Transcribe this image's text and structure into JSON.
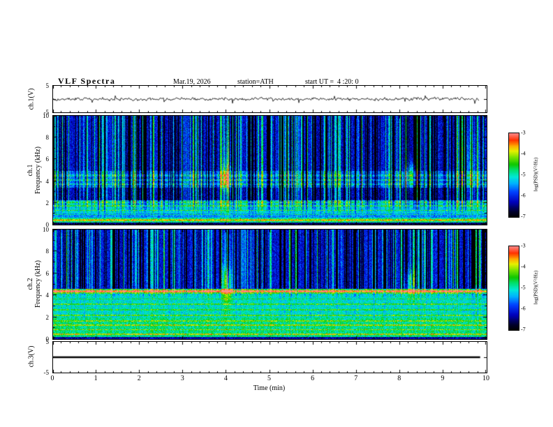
{
  "header": {
    "title": "VLF Spectra",
    "date": "Mar.19, 2026",
    "station": "station=ATH",
    "start_ut": "start UT =  4 :20: 0"
  },
  "panels": {
    "wave1": {
      "rot_label": "ch.1(V)"
    },
    "spec1": {
      "channel": "ch.1",
      "axis": "Frequency (kHz)"
    },
    "spec2": {
      "channel": "ch.2",
      "axis": "Frequency (kHz)"
    },
    "wave3": {
      "rot_label": "ch.3(V)"
    }
  },
  "axes": {
    "x": {
      "label": "Time (min)",
      "ticks": [
        0,
        1,
        2,
        3,
        4,
        5,
        6,
        7,
        8,
        9,
        10
      ]
    },
    "spec_y": {
      "ticks": [
        0,
        2,
        4,
        6,
        8,
        10
      ]
    },
    "wave_y": {
      "ticks": [
        5,
        -5
      ]
    },
    "colorbar": {
      "label": "log(PSD)(V²/Hz)",
      "ticks": [
        -3,
        -4,
        -5,
        -6,
        -7
      ]
    }
  },
  "colormap": [
    {
      "t": 0.0,
      "c": "#000000"
    },
    {
      "t": 0.07,
      "c": "#000030"
    },
    {
      "t": 0.18,
      "c": "#0000bb"
    },
    {
      "t": 0.3,
      "c": "#0040ff"
    },
    {
      "t": 0.4,
      "c": "#00b0ff"
    },
    {
      "t": 0.48,
      "c": "#00e8d8"
    },
    {
      "t": 0.56,
      "c": "#00e070"
    },
    {
      "t": 0.63,
      "c": "#10c800"
    },
    {
      "t": 0.72,
      "c": "#80e400"
    },
    {
      "t": 0.79,
      "c": "#e8f000"
    },
    {
      "t": 0.85,
      "c": "#ffa800"
    },
    {
      "t": 0.92,
      "c": "#ff3000"
    },
    {
      "t": 1.0,
      "c": "#ff8888"
    }
  ],
  "chart_data": [
    {
      "type": "line",
      "name": "ch.1 waveform",
      "ylabel": "ch.1(V)",
      "ylim": [
        -5,
        5
      ],
      "xlim": [
        0,
        10
      ],
      "description": "broadband noise around 0 V, about ±1 V, with intermittent impulsive spikes up to about ±3 V",
      "render": {
        "seed": 101,
        "noise_amp": 0.85,
        "spike_prob": 0.02,
        "spike_amp": 2.2,
        "end_frac": 0.985
      }
    },
    {
      "type": "heatmap",
      "name": "ch.1 spectrogram",
      "ylabel": "Frequency (kHz)",
      "ylim": [
        0,
        10
      ],
      "xlim": [
        0,
        10
      ],
      "value_label": "log(PSD)(V²/Hz)",
      "value_range": [
        -7,
        -3
      ],
      "features": [
        "dense vertical sferic streaks spanning 2-10 kHz",
        "banded emissions below 2.3 kHz (green with red speckle lines)",
        "hiss band near 3.4-5 kHz",
        "bright emission burst at 4.0 min, 3-6 kHz",
        "weaker burst at 8.25 min, 3.5-5.5 kHz",
        "diffuse enhancement near 9.6 min above 3 kHz"
      ],
      "render": {
        "seed": 202,
        "noise": 0.75,
        "dark_streak_prob": 0.3,
        "bright_streak_prob": 0.22,
        "streak_min_f": 1.0,
        "streak_full_f": 2.6,
        "bands": [
          {
            "f0": 0,
            "f1": 0.25,
            "v": -6.6
          },
          {
            "f0": 0.25,
            "f1": 0.7,
            "v": -4.9
          },
          {
            "f0": 0.7,
            "f1": 1.05,
            "v": -5.5
          },
          {
            "f0": 1.05,
            "f1": 2.3,
            "v": -5.15
          },
          {
            "f0": 2.3,
            "f1": 3.4,
            "v": -6.25
          },
          {
            "f0": 3.4,
            "f1": 5.0,
            "v": -5.65
          },
          {
            "f0": 5.0,
            "f1": 10.01,
            "v": -6.15
          }
        ],
        "lines": [
          {
            "f": 0.45,
            "w": 0.07,
            "amp": 1.25
          },
          {
            "f": 0.95,
            "w": 0.05,
            "amp": 0.85
          },
          {
            "f": 1.35,
            "w": 0.06,
            "amp": 0.8
          },
          {
            "f": 1.75,
            "w": 0.06,
            "amp": 0.7
          },
          {
            "f": 2.1,
            "w": 0.05,
            "amp": 0.6
          },
          {
            "f": 3.75,
            "w": 0.08,
            "amp": 0.65
          },
          {
            "f": 4.15,
            "w": 0.08,
            "amp": 0.75
          },
          {
            "f": 4.55,
            "w": 0.07,
            "amp": 0.55
          }
        ],
        "blobs": [
          {
            "x": 4.0,
            "fc": 4.3,
            "sx": 0.12,
            "sf": 1.1,
            "amp": 1.5
          },
          {
            "x": 4.0,
            "fc": 5.5,
            "sx": 0.1,
            "sf": 4.5,
            "amp": 0.8
          },
          {
            "x": 8.25,
            "fc": 4.6,
            "sx": 0.15,
            "sf": 1.1,
            "amp": 1.2
          },
          {
            "x": 9.6,
            "fc": 5.5,
            "sx": 0.28,
            "sf": 3.0,
            "amp": 0.5
          }
        ]
      }
    },
    {
      "type": "heatmap",
      "name": "ch.2 spectrogram",
      "ylabel": "Frequency (kHz)",
      "ylim": [
        0,
        10
      ],
      "xlim": [
        0,
        10
      ],
      "value_label": "log(PSD)(V²/Hz)",
      "value_range": [
        -7,
        -3
      ],
      "features": [
        "dense vertical sferic streaks above 5 kHz",
        "strong red narrowband line near 4.4 kHz",
        "broad green emission region 0.2-4.2 kHz with orange/red horizontal lines",
        "bright emission burst at 4.0 min, 4-6.5 kHz",
        "weaker burst at 8.25 min, 4-6 kHz"
      ],
      "render": {
        "seed": 303,
        "noise": 0.75,
        "dark_streak_prob": 0.3,
        "bright_streak_prob": 0.2,
        "streak_min_f": 3.8,
        "streak_full_f": 5.2,
        "bands": [
          {
            "f0": 0,
            "f1": 0.2,
            "v": -6.3
          },
          {
            "f0": 0.2,
            "f1": 2.0,
            "v": -4.8
          },
          {
            "f0": 2.0,
            "f1": 4.2,
            "v": -5.05
          },
          {
            "f0": 4.2,
            "f1": 4.6,
            "v": -4.35
          },
          {
            "f0": 4.6,
            "f1": 10.01,
            "v": -6.1
          }
        ],
        "lines": [
          {
            "f": 0.5,
            "w": 0.06,
            "amp": 1.1
          },
          {
            "f": 0.9,
            "w": 0.05,
            "amp": 0.85
          },
          {
            "f": 1.3,
            "w": 0.05,
            "amp": 0.95
          },
          {
            "f": 1.7,
            "w": 0.05,
            "amp": 0.75
          },
          {
            "f": 2.2,
            "w": 0.05,
            "amp": 0.9
          },
          {
            "f": 2.7,
            "w": 0.05,
            "amp": 0.7
          },
          {
            "f": 3.2,
            "w": 0.05,
            "amp": 0.8
          },
          {
            "f": 3.7,
            "w": 0.05,
            "amp": 0.6
          },
          {
            "f": 4.4,
            "w": 0.09,
            "amp": 1.8
          }
        ],
        "blobs": [
          {
            "x": 4.0,
            "fc": 5.2,
            "sx": 0.12,
            "sf": 1.3,
            "amp": 1.4
          },
          {
            "x": 4.0,
            "fc": 6.5,
            "sx": 0.1,
            "sf": 4.0,
            "amp": 0.7
          },
          {
            "x": 8.25,
            "fc": 5.2,
            "sx": 0.15,
            "sf": 1.2,
            "amp": 1.1
          }
        ]
      }
    },
    {
      "type": "line",
      "name": "ch.3 waveform",
      "ylabel": "ch.3(V)",
      "ylim": [
        -5,
        5
      ],
      "xlim": [
        0,
        10
      ],
      "description": "flat line at 0 V (no signal)",
      "render": {
        "flat": true,
        "line_width": 2.5,
        "end_frac": 0.985,
        "seed": 0
      }
    }
  ]
}
